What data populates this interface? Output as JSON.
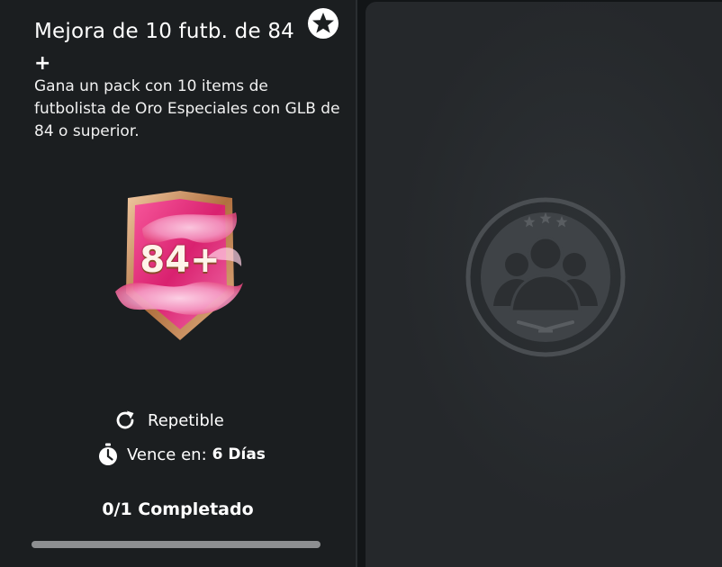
{
  "objective": {
    "title": "Mejora de 10 futb. de 84",
    "plus": "+",
    "description": "Gana un pack con 10 items de futbolista de Oro Especiales con GLB de 84 o superior.",
    "pack_label": "84+",
    "repeatable_label": "Repetible",
    "expires_label": "Vence en:",
    "expires_value": "6 Días",
    "completed_label": "0/1 Completado",
    "progress": 0
  },
  "icons": {
    "badge": "star-icon",
    "repeat": "refresh-icon",
    "timer": "stopwatch-icon",
    "placeholder": "player-group-emblem-icon"
  },
  "colors": {
    "panel": "#1b1e20",
    "card": "#25282b",
    "pack_pink": "#e83a8a",
    "pack_bronze": "#c98c5d",
    "progress": "#8d8f91"
  }
}
